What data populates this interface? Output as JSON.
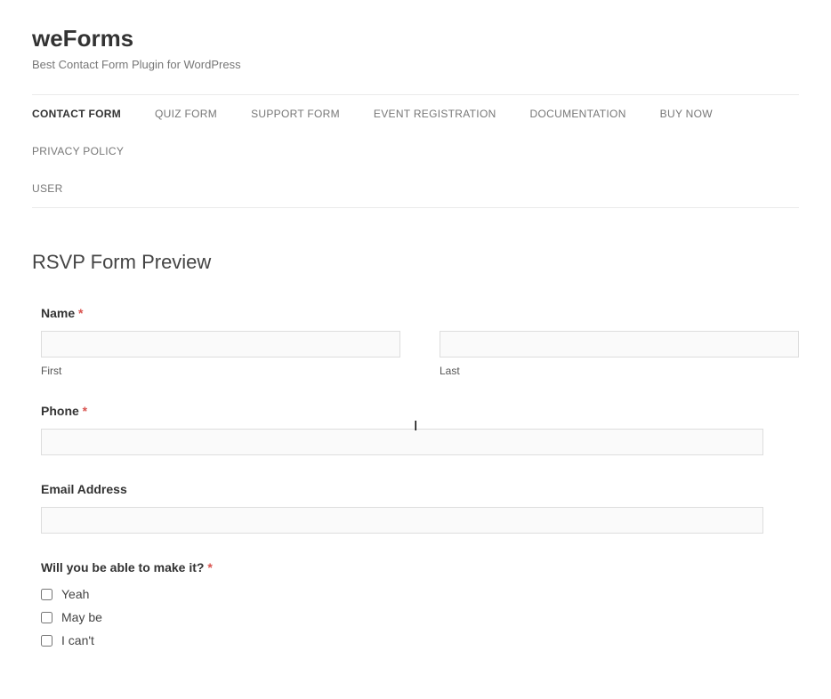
{
  "header": {
    "title": "weForms",
    "tagline": "Best Contact Form Plugin for WordPress"
  },
  "nav": {
    "items": [
      {
        "label": "CONTACT FORM",
        "active": true
      },
      {
        "label": "QUIZ FORM",
        "active": false
      },
      {
        "label": "SUPPORT FORM",
        "active": false
      },
      {
        "label": "EVENT REGISTRATION",
        "active": false
      },
      {
        "label": "DOCUMENTATION",
        "active": false
      },
      {
        "label": "BUY NOW",
        "active": false
      },
      {
        "label": "PRIVACY POLICY",
        "active": false
      },
      {
        "label": "USER",
        "active": false
      }
    ]
  },
  "page": {
    "title": "RSVP Form Preview"
  },
  "form": {
    "name": {
      "label": "Name",
      "required_mark": "*",
      "first_sub": "First",
      "last_sub": "Last",
      "first_value": "",
      "last_value": ""
    },
    "phone": {
      "label": "Phone",
      "required_mark": "*",
      "value": ""
    },
    "email": {
      "label": "Email Address",
      "value": ""
    },
    "attend": {
      "label": "Will you be able to make it?",
      "required_mark": "*",
      "options": [
        {
          "label": "Yeah",
          "checked": false
        },
        {
          "label": "May be",
          "checked": false
        },
        {
          "label": "I can't",
          "checked": false
        }
      ]
    }
  }
}
